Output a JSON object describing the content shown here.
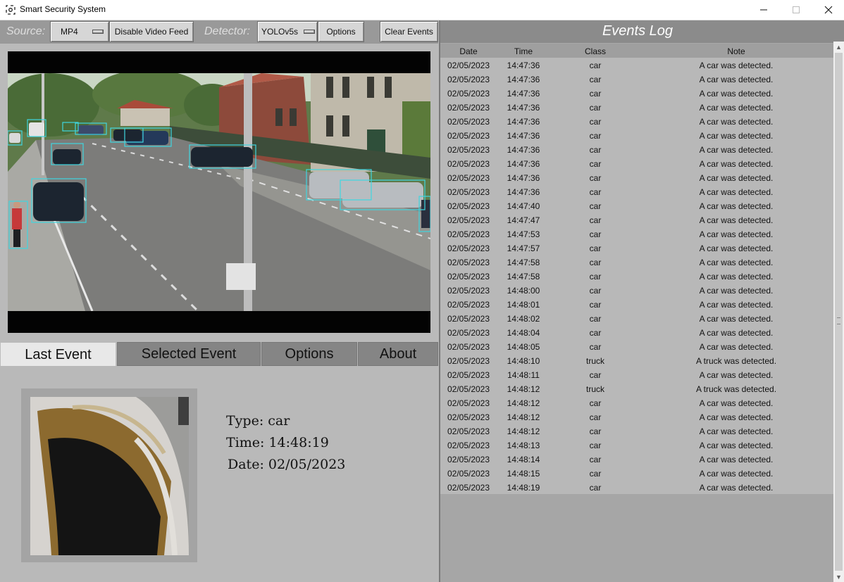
{
  "window": {
    "title": "Smart Security System",
    "icons": {
      "app": "camera-target-icon",
      "minimize": "minimize-icon",
      "maximize": "maximize-icon",
      "close": "close-icon"
    }
  },
  "toolbar": {
    "source_label": "Source:",
    "source_value": "MP4",
    "disable_feed_label": "Disable Video Feed",
    "detector_label": "Detector:",
    "detector_value": "YOLOv5s",
    "options_label": "Options",
    "clear_events_label": "Clear Events"
  },
  "tabs": [
    {
      "label": "Last Event",
      "active": true
    },
    {
      "label": "Selected Event",
      "active": false
    },
    {
      "label": "Options",
      "active": false
    },
    {
      "label": "About",
      "active": false
    }
  ],
  "last_event": {
    "type_label": "Type:",
    "type_value": "car",
    "time_label": "Time:",
    "time_value": "14:48:19",
    "date_label": "Date:",
    "date_value": "02/05/2023"
  },
  "events_log": {
    "title": "Events Log",
    "columns": [
      "Date",
      "Time",
      "Class",
      "Note"
    ],
    "rows": [
      [
        "02/05/2023",
        "14:47:36",
        "car",
        "A car was detected."
      ],
      [
        "02/05/2023",
        "14:47:36",
        "car",
        "A car was detected."
      ],
      [
        "02/05/2023",
        "14:47:36",
        "car",
        "A car was detected."
      ],
      [
        "02/05/2023",
        "14:47:36",
        "car",
        "A car was detected."
      ],
      [
        "02/05/2023",
        "14:47:36",
        "car",
        "A car was detected."
      ],
      [
        "02/05/2023",
        "14:47:36",
        "car",
        "A car was detected."
      ],
      [
        "02/05/2023",
        "14:47:36",
        "car",
        "A car was detected."
      ],
      [
        "02/05/2023",
        "14:47:36",
        "car",
        "A car was detected."
      ],
      [
        "02/05/2023",
        "14:47:36",
        "car",
        "A car was detected."
      ],
      [
        "02/05/2023",
        "14:47:36",
        "car",
        "A car was detected."
      ],
      [
        "02/05/2023",
        "14:47:40",
        "car",
        "A car was detected."
      ],
      [
        "02/05/2023",
        "14:47:47",
        "car",
        "A car was detected."
      ],
      [
        "02/05/2023",
        "14:47:53",
        "car",
        "A car was detected."
      ],
      [
        "02/05/2023",
        "14:47:57",
        "car",
        "A car was detected."
      ],
      [
        "02/05/2023",
        "14:47:58",
        "car",
        "A car was detected."
      ],
      [
        "02/05/2023",
        "14:47:58",
        "car",
        "A car was detected."
      ],
      [
        "02/05/2023",
        "14:48:00",
        "car",
        "A car was detected."
      ],
      [
        "02/05/2023",
        "14:48:01",
        "car",
        "A car was detected."
      ],
      [
        "02/05/2023",
        "14:48:02",
        "car",
        "A car was detected."
      ],
      [
        "02/05/2023",
        "14:48:04",
        "car",
        "A car was detected."
      ],
      [
        "02/05/2023",
        "14:48:05",
        "car",
        "A car was detected."
      ],
      [
        "02/05/2023",
        "14:48:10",
        "truck",
        "A truck was detected."
      ],
      [
        "02/05/2023",
        "14:48:11",
        "car",
        "A car was detected."
      ],
      [
        "02/05/2023",
        "14:48:12",
        "truck",
        "A truck was detected."
      ],
      [
        "02/05/2023",
        "14:48:12",
        "car",
        "A car was detected."
      ],
      [
        "02/05/2023",
        "14:48:12",
        "car",
        "A car was detected."
      ],
      [
        "02/05/2023",
        "14:48:12",
        "car",
        "A car was detected."
      ],
      [
        "02/05/2023",
        "14:48:13",
        "car",
        "A car was detected."
      ],
      [
        "02/05/2023",
        "14:48:14",
        "car",
        "A car was detected."
      ],
      [
        "02/05/2023",
        "14:48:15",
        "car",
        "A car was detected."
      ],
      [
        "02/05/2023",
        "14:48:19",
        "car",
        "A car was detected."
      ]
    ]
  },
  "colors": {
    "detection_box": "#3fd6e0",
    "toolbar": "#999999",
    "log_header": "#8b8b8b"
  }
}
